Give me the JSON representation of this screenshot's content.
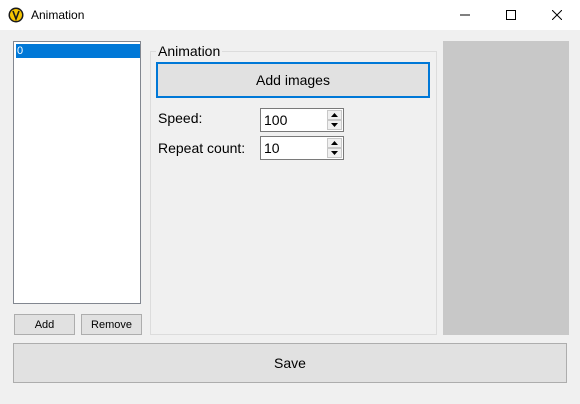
{
  "window": {
    "title": "Animation",
    "icon": "app-icon"
  },
  "frames_list": {
    "items": [
      {
        "label": "0",
        "selected": true
      }
    ]
  },
  "list_buttons": {
    "add_label": "Add",
    "remove_label": "Remove"
  },
  "animation_group": {
    "title": "Animation",
    "add_images_label": "Add images",
    "speed": {
      "label": "Speed:",
      "value": "100"
    },
    "repeat_count": {
      "label": "Repeat count:",
      "value": "10"
    }
  },
  "save_label": "Save",
  "colors": {
    "accent": "#0078d7",
    "preview_bg": "#c8c8c8",
    "window_bg": "#f0f0f0"
  }
}
